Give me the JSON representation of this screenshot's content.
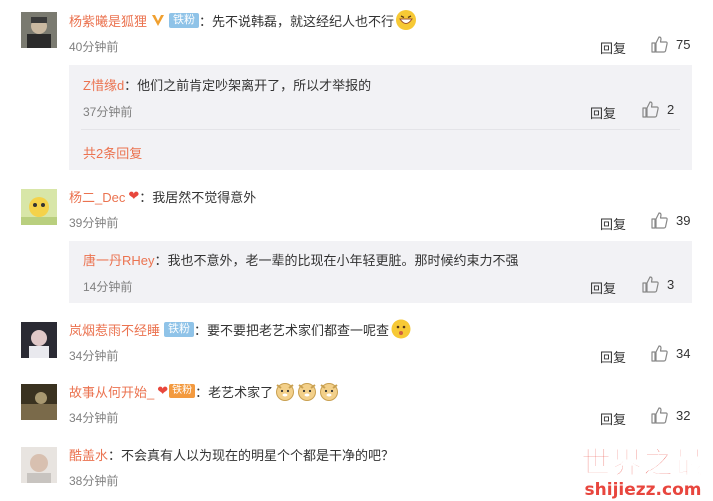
{
  "comments": [
    {
      "user": "杨紫曦是狐狸",
      "text": "：先不说韩磊，就这经纪人也不行",
      "badge": "铁粉",
      "time": "40分钟前",
      "reply": "回复",
      "likes": "75",
      "subreplies": [
        {
          "user": "Z惜缘d",
          "text": "：他们之前肯定吵架离开了，所以才举报的",
          "time": "37分钟前",
          "reply": "回复",
          "likes": "2"
        }
      ],
      "more": "共2条回复"
    },
    {
      "user": "杨二_Dec",
      "text": "：我居然不觉得意外",
      "time": "39分钟前",
      "reply": "回复",
      "likes": "39",
      "subreplies": [
        {
          "user": "唐一丹RHey",
          "text": "：我也不意外，老一辈的比现在小年轻更脏。那时候约束力不强",
          "time": "14分钟前",
          "reply": "回复",
          "likes": "3"
        }
      ]
    },
    {
      "user": "岚烟惹雨不经睡",
      "text": "：要不要把老艺术家们都查一呢查",
      "badge": "铁粉",
      "time": "34分钟前",
      "reply": "回复",
      "likes": "34"
    },
    {
      "user": "故事从何开始_",
      "text": "：老艺术家了",
      "badge": "铁粉",
      "time": "34分钟前",
      "reply": "回复",
      "likes": "32"
    },
    {
      "user": "酷盖水",
      "text": "：不会真有人以为现在的明星个个都是干净的吧？",
      "time": "38分钟前"
    }
  ],
  "watermark": {
    "title": "世界之最",
    "domain": "shijiezz.com"
  },
  "colors": {
    "username": "#eb7350",
    "time": "#808080",
    "subreply_bg": "#f2f2f5",
    "badge_bg": "#8fc3e8"
  }
}
